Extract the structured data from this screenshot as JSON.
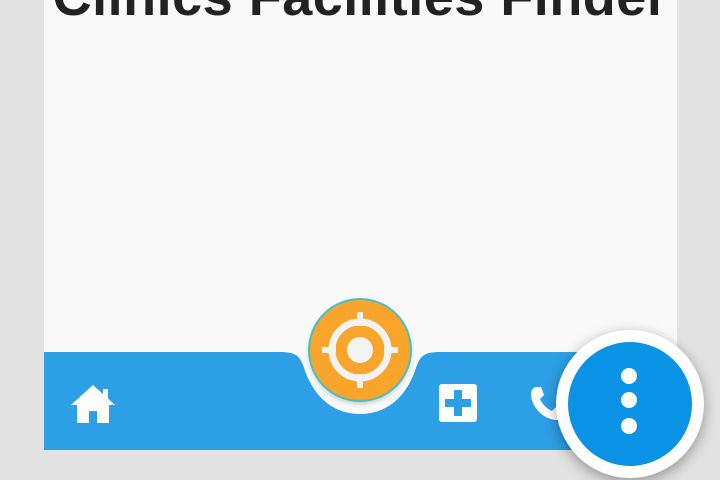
{
  "app": {
    "title": "Clinics Facilities Finder"
  },
  "bottom_nav": {
    "items": [
      {
        "icon": "home-icon"
      },
      {
        "icon": "medical-cross-icon"
      },
      {
        "icon": "phone-icon"
      }
    ],
    "center_action_icon": "crosshair-locate-icon"
  },
  "overflow_menu": {
    "icon": "more-vert-icon"
  },
  "colors": {
    "background": "#e2e2e2",
    "screen": "#f9f9f9",
    "bar": "#2d9fe6",
    "locate_fab": "#f9a52b",
    "locate_fab_ring": "#46c0c8",
    "menu_fab": "#0a92e4",
    "title_text": "#222222"
  }
}
